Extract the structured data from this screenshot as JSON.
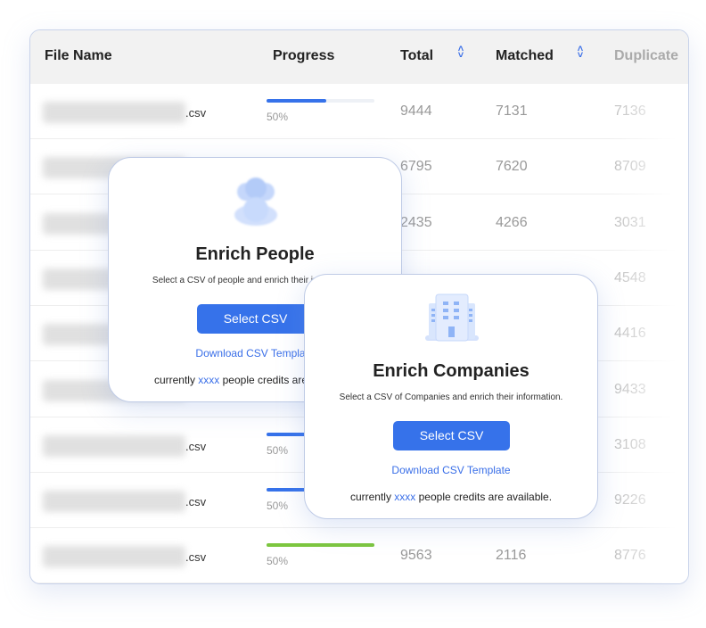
{
  "table": {
    "headers": {
      "file": "File Name",
      "progress": "Progress",
      "total": "Total",
      "matched": "Matched",
      "duplicate": "Duplicate"
    },
    "sort_icon": "sort-updown-icon",
    "rows": [
      {
        "ext": ".csv",
        "progress": 55,
        "pct": "50%",
        "color": "#3672ea",
        "total": "9444",
        "matched": "7131",
        "dup": "7136"
      },
      {
        "ext": "",
        "total": "6795",
        "matched": "7620",
        "dup": "8709"
      },
      {
        "ext": "",
        "total": "2435",
        "matched": "4266",
        "dup": "3031"
      },
      {
        "ext": "",
        "total": "",
        "matched": "",
        "dup": "4548"
      },
      {
        "ext": "",
        "total": "",
        "matched": "",
        "dup": "4416"
      },
      {
        "ext": "",
        "total": "",
        "matched": "",
        "dup": "9433"
      },
      {
        "ext": ".csv",
        "progress": 55,
        "pct": "50%",
        "color": "#3672ea",
        "total": "",
        "matched": "",
        "dup": "3108"
      },
      {
        "ext": ".csv",
        "progress": 55,
        "pct": "50%",
        "color": "#3672ea",
        "total": "",
        "matched": "",
        "dup": "9226"
      },
      {
        "ext": ".csv",
        "progress": 100,
        "pct": "50%",
        "color": "#7cc63f",
        "total": "9563",
        "matched": "2116",
        "dup": "8776"
      }
    ]
  },
  "people": {
    "icon": "people-icon",
    "title": "Enrich People",
    "subtitle": "Select a CSV of people and enrich their information.",
    "button": "Select CSV",
    "link": "Download CSV Template",
    "credits_pre": "currently ",
    "credits_val": "xxxx",
    "credits_post": " people credits are available."
  },
  "companies": {
    "icon": "building-icon",
    "title": "Enrich Companies",
    "subtitle": "Select a CSV of Companies and enrich their information.",
    "button": "Select CSV",
    "link": "Download CSV Template",
    "credits_pre": "currently ",
    "credits_val": "xxxx",
    "credits_post": " people credits are available."
  }
}
